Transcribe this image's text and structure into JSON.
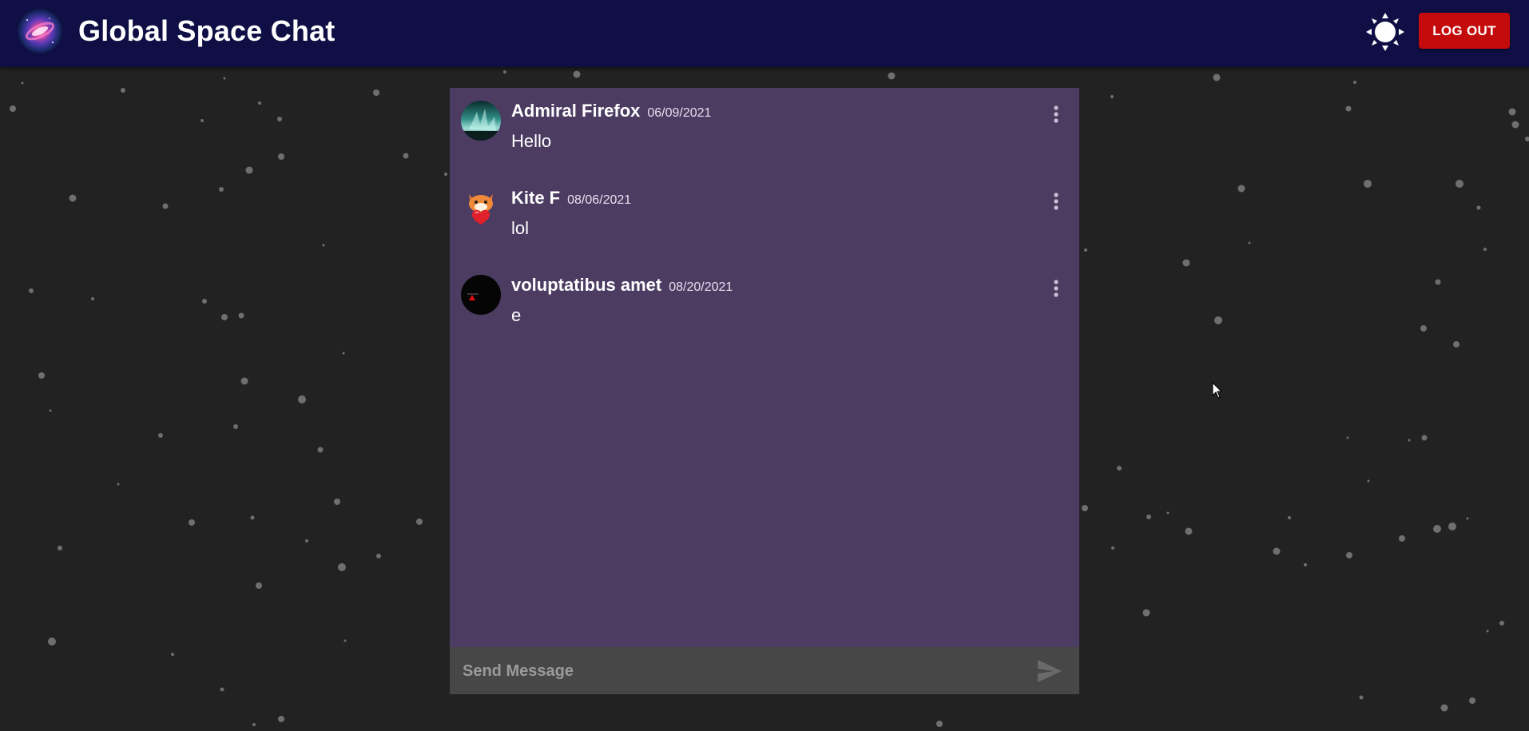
{
  "header": {
    "title": "Global Space Chat",
    "logo_icon": "galaxy-logo-icon",
    "theme_icon": "sun-icon",
    "logout_label": "LOG OUT"
  },
  "messages": [
    {
      "author": "Admiral Firefox",
      "date": "06/09/2021",
      "text": "Hello",
      "avatar_icon": "aurora-avatar"
    },
    {
      "author": "Kite F",
      "date": "08/06/2021",
      "text": "lol",
      "avatar_icon": "fox-heart-avatar"
    },
    {
      "author": "voluptatibus amet",
      "date": "08/20/2021",
      "text": "e",
      "avatar_icon": "dark-avatar"
    }
  ],
  "composer": {
    "placeholder": "Send Message",
    "value": "",
    "send_icon": "send-icon"
  },
  "colors": {
    "background": "#222222",
    "appbar": "#0f0f45",
    "chat_panel": "#4c3c62",
    "input_bar": "#474747",
    "logout": "#c40b0b",
    "star": "#6a6a6a"
  }
}
